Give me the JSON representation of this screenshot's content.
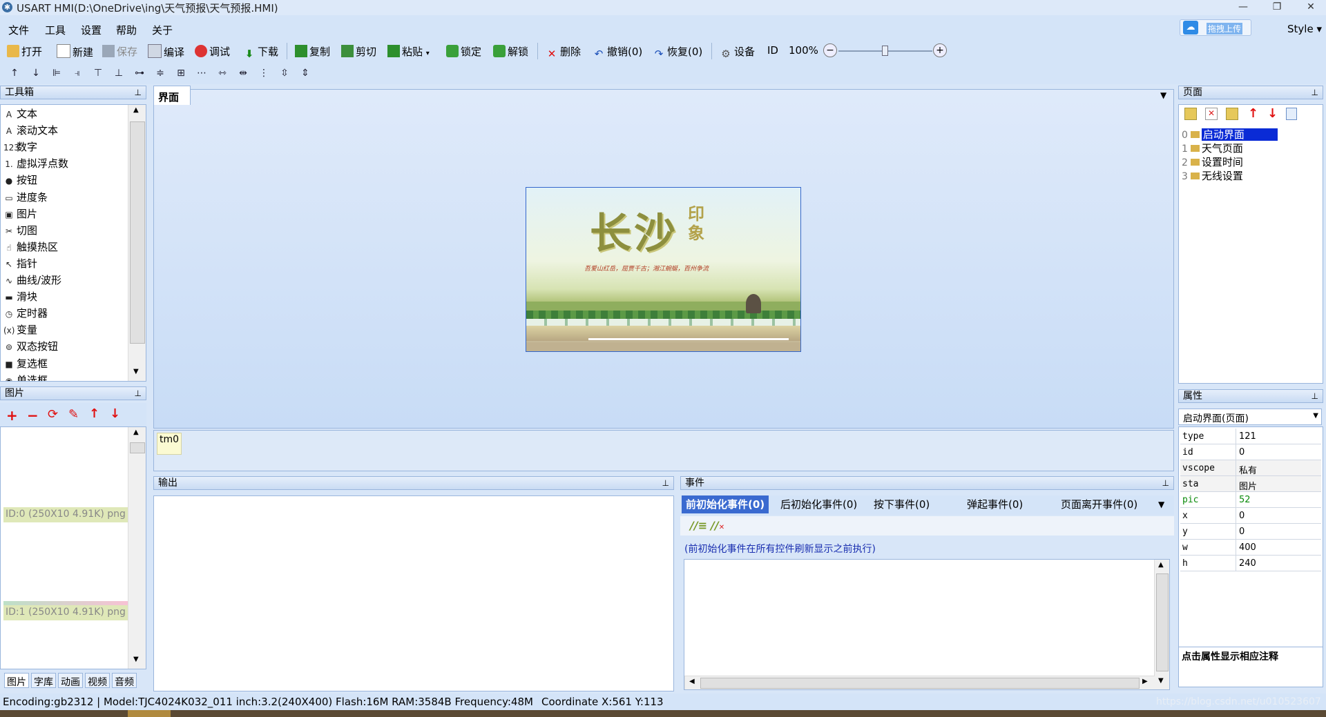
{
  "window": {
    "title": "USART  HMI(D:\\OneDrive\\ing\\天气预报\\天气预报.HMI)",
    "controls": [
      "—",
      "❐",
      "✕"
    ]
  },
  "menu": [
    "文件",
    "工具",
    "设置",
    "帮助",
    "关于"
  ],
  "topright": {
    "upload_label": "拖拽上传",
    "style_label": "Style ▾"
  },
  "toolbar1": {
    "open": "打开",
    "new": "新建",
    "save": "保存",
    "compile": "编译",
    "debug": "调试",
    "download": "下载",
    "copy": "复制",
    "cut": "剪切",
    "paste": "粘贴",
    "lock": "锁定",
    "unlock": "解锁",
    "delete": "删除",
    "undo": "撤销(0)",
    "redo": "恢复(0)",
    "device": "设备",
    "id": "ID",
    "zoom": "100%",
    "zoom_level": 0.5
  },
  "toolbox": {
    "title": "工具箱",
    "items": [
      {
        "icon": "A",
        "label": "文本"
      },
      {
        "icon": "A",
        "label": "滚动文本"
      },
      {
        "icon": "123",
        "label": "数字"
      },
      {
        "icon": "1.",
        "label": "虚拟浮点数"
      },
      {
        "icon": "●",
        "label": "按钮"
      },
      {
        "icon": "▭",
        "label": "进度条"
      },
      {
        "icon": "▣",
        "label": "图片"
      },
      {
        "icon": "✂",
        "label": "切图"
      },
      {
        "icon": "☝",
        "label": "触摸热区"
      },
      {
        "icon": "↖",
        "label": "指针"
      },
      {
        "icon": "∿",
        "label": "曲线/波形"
      },
      {
        "icon": "▬",
        "label": "滑块"
      },
      {
        "icon": "◷",
        "label": "定时器"
      },
      {
        "icon": "(x)",
        "label": "变量"
      },
      {
        "icon": "⊚",
        "label": "双态按钮"
      },
      {
        "icon": "■",
        "label": "复选框"
      },
      {
        "icon": "◉",
        "label": "单选框"
      }
    ]
  },
  "pictures": {
    "title": "图片",
    "items": [
      "ID:0  (250X10 4.91K) png",
      "ID:1  (250X10 4.91K) png"
    ],
    "tabs": [
      "图片",
      "字库",
      "动画",
      "视频",
      "音频"
    ]
  },
  "designer": {
    "tab": "界面",
    "screen": {
      "title_big": "长沙",
      "title_small": "印象",
      "slogan": "吾爱山红岳，屈贾千古；湘江蜿蜒，百州争流"
    },
    "timer": "tm0"
  },
  "output": {
    "title": "输出"
  },
  "events": {
    "title": "事件",
    "tabs": [
      "前初始化事件(0)",
      "后初始化事件(0)",
      "按下事件(0)",
      "弹起事件(0)",
      "页面离开事件(0)"
    ],
    "note": "(前初始化事件在所有控件刷新显示之前执行)"
  },
  "pages": {
    "title": "页面",
    "items": [
      {
        "index": "0",
        "label": "启动界面",
        "selected": true
      },
      {
        "index": "1",
        "label": "天气页面"
      },
      {
        "index": "2",
        "label": "设置时间"
      },
      {
        "index": "3",
        "label": "无线设置"
      }
    ]
  },
  "attributes": {
    "title": "属性",
    "selector": "启动界面(页面)",
    "rows": [
      {
        "k": "type",
        "v": "121",
        "green": false
      },
      {
        "k": "id",
        "v": "0",
        "green": false
      },
      {
        "k": "vscope",
        "v": "私有",
        "green": false
      },
      {
        "k": "sta",
        "v": "图片",
        "green": false
      },
      {
        "k": "pic",
        "v": "52",
        "green": true
      },
      {
        "k": "x",
        "v": "0",
        "green": false
      },
      {
        "k": "y",
        "v": "0",
        "green": false
      },
      {
        "k": "w",
        "v": "400",
        "green": false
      },
      {
        "k": "h",
        "v": "240",
        "green": false
      }
    ],
    "hint": "点击属性显示相应注释"
  },
  "status": {
    "left": "Encoding:gb2312  |  Model:TJC4024K032_011  inch:3.2(240X400) Flash:16M RAM:3584B Frequency:48M",
    "coord": "Coordinate X:561  Y:113",
    "watermark": "https://blog.csdn.net/u010523607"
  },
  "colors": {
    "selection": "#0a2bd6",
    "green_value": "#0a8a0a",
    "accent": "#3a6ea5"
  }
}
